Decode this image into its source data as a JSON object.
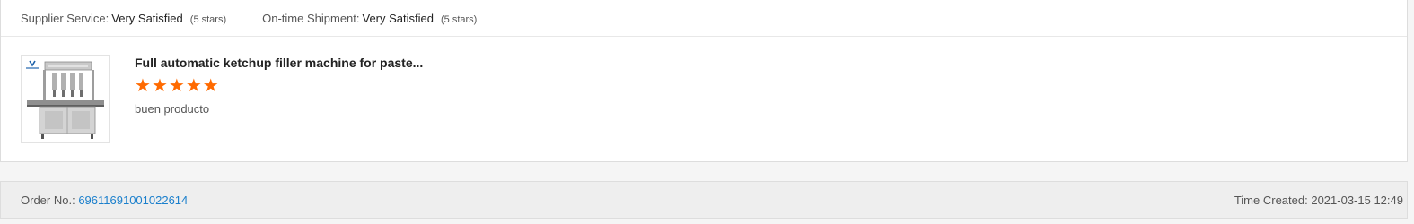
{
  "ratings": {
    "supplier_service_label": "Supplier Service:",
    "supplier_service_value": "Very Satisfied",
    "supplier_service_stars": "(5 stars)",
    "ontime_shipment_label": "On-time Shipment:",
    "ontime_shipment_value": "Very Satisfied",
    "ontime_shipment_stars": "(5 stars)"
  },
  "product": {
    "title": "Full automatic ketchup filler machine for paste...",
    "star_count": 5,
    "review": "buen producto",
    "thumbnail_icon": "filling-machine-image"
  },
  "order": {
    "order_no_label": "Order No.:",
    "order_no": "69611691001022614",
    "time_created_label": "Time Created:",
    "time_created": "2021-03-15 12:49"
  },
  "colors": {
    "star": "#ff6a00",
    "link": "#1a7fcc"
  }
}
